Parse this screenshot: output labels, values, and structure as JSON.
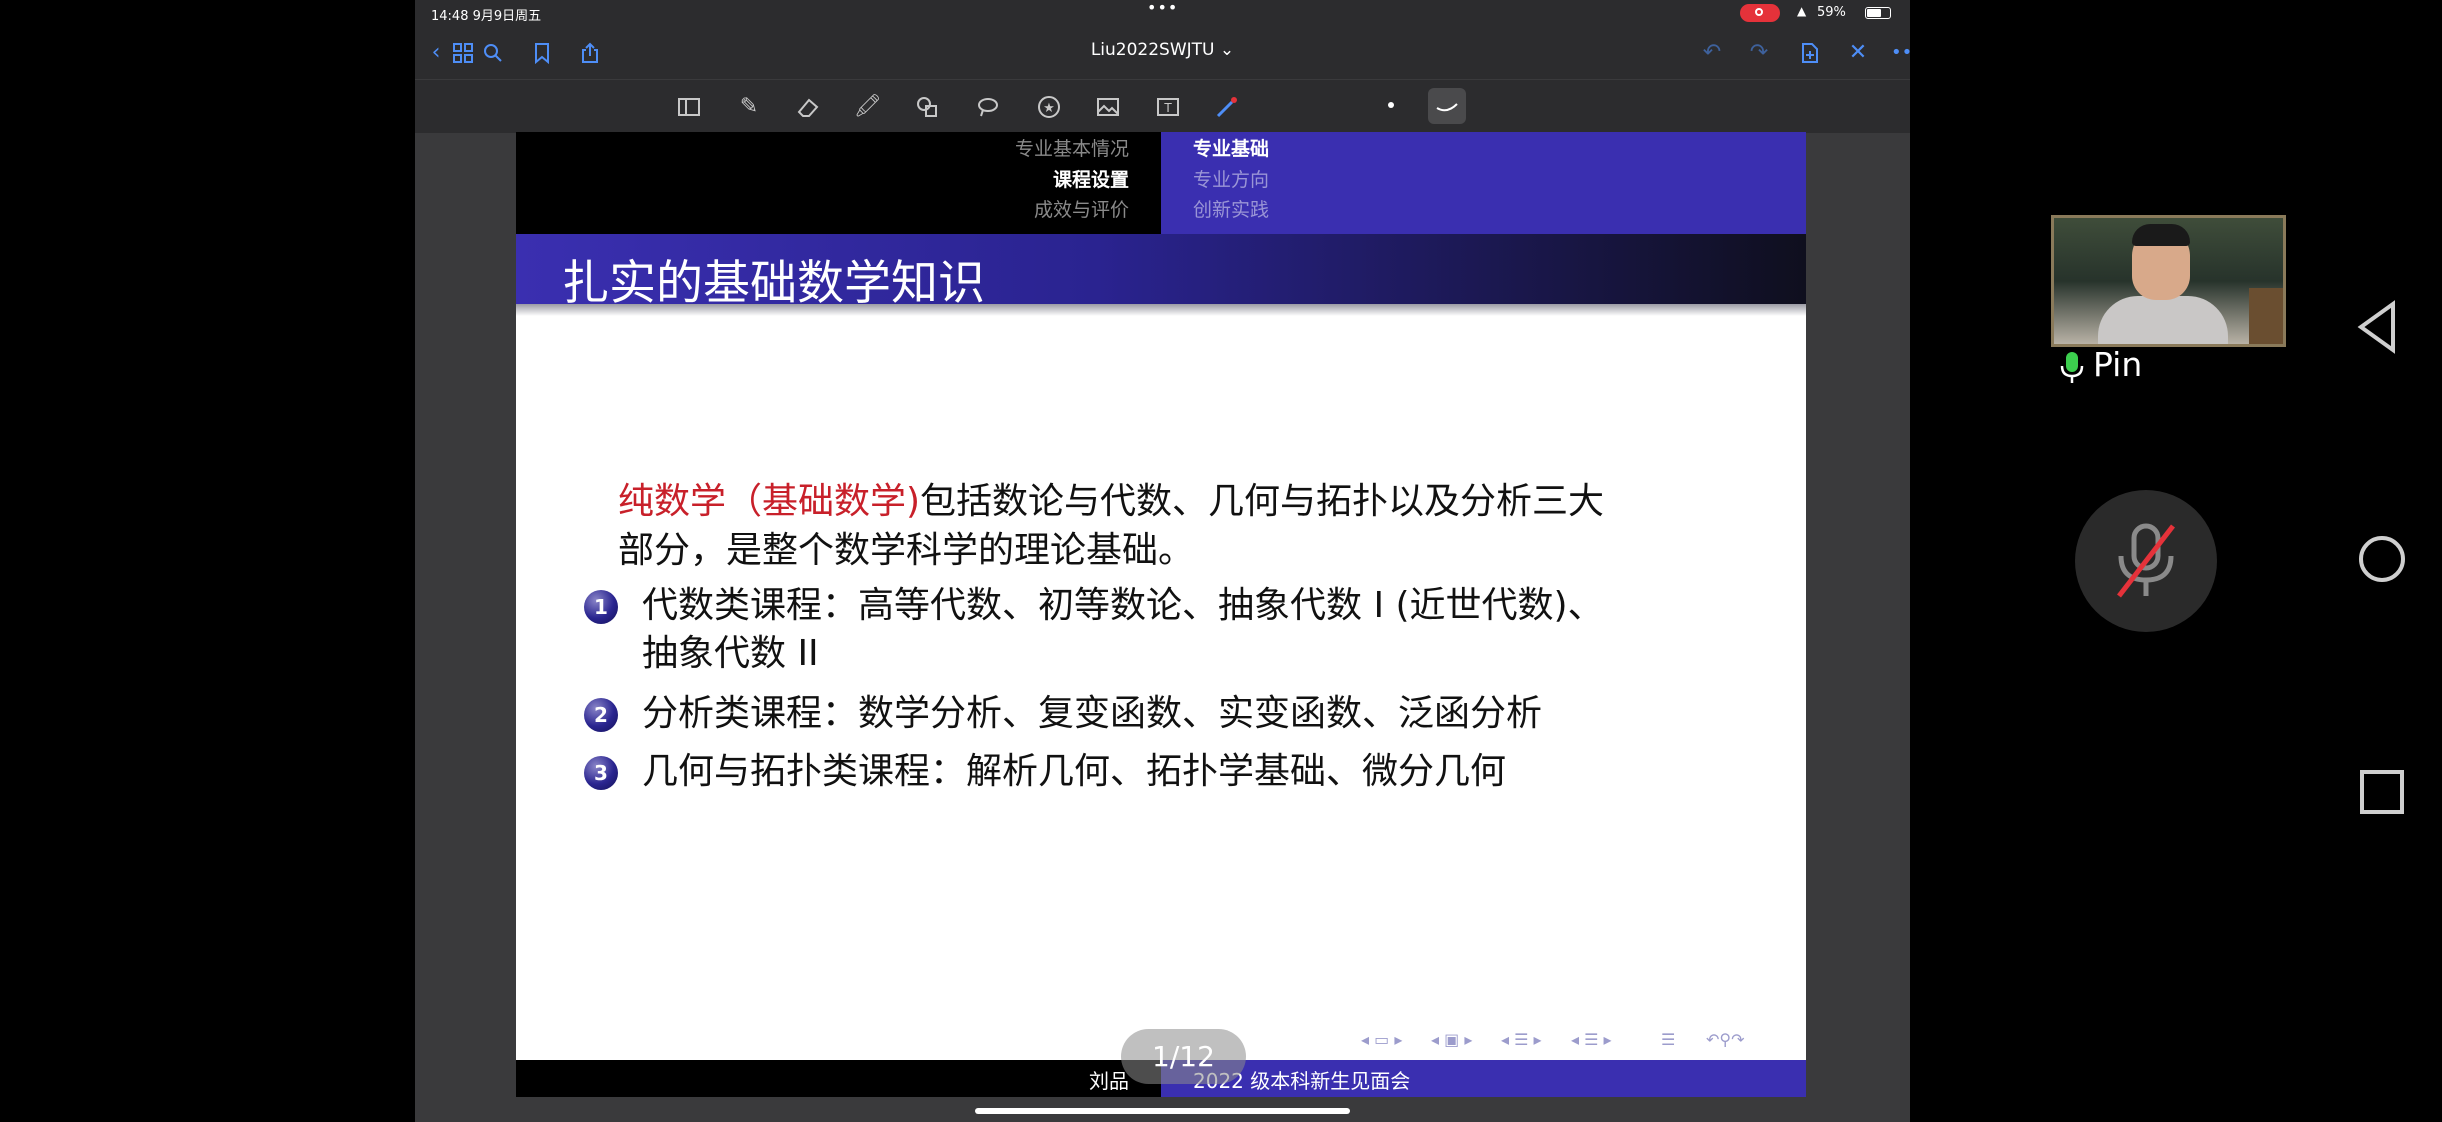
{
  "status_bar": {
    "time": "14:48 9月9日周五",
    "battery": "59%",
    "battery_level": 0.59
  },
  "nav": {
    "title": "Liu2022SWJTU ⌄"
  },
  "slide": {
    "header_left": [
      "专业基本情况",
      "课程设置",
      "成效与评价"
    ],
    "header_left_active": 1,
    "header_right": [
      "专业基础",
      "专业方向",
      "创新实践"
    ],
    "header_right_active": 0,
    "title": "扎实的基础数学知识",
    "intro_red": "纯数学（基础数学)",
    "intro_rest_line1": "包括数论与代数、几何与拓扑以及分析三大",
    "intro_line2": "部分，是整个数学科学的理论基础。",
    "items": [
      {
        "num": "1",
        "line1": "代数类课程：高等代数、初等数论、抽象代数 I (近世代数)、",
        "line2": "抽象代数 II"
      },
      {
        "num": "2",
        "line1": "分析类课程：数学分析、复变函数、实变函数、泛函分析",
        "line2": ""
      },
      {
        "num": "3",
        "line1": "几何与拓扑类课程：解析几何、拓扑学基础、微分几何",
        "line2": ""
      }
    ],
    "footer_left": "刘品",
    "footer_right": "2022 级本科新生见面会",
    "page_indicator": "1/12"
  },
  "meeting": {
    "participant_name": "Pin"
  },
  "colors": {
    "accent": "#4e8ef7",
    "beamer_blue": "#3a2fb0",
    "highlight_red": "#c8202a",
    "record_red": "#e5323a"
  }
}
